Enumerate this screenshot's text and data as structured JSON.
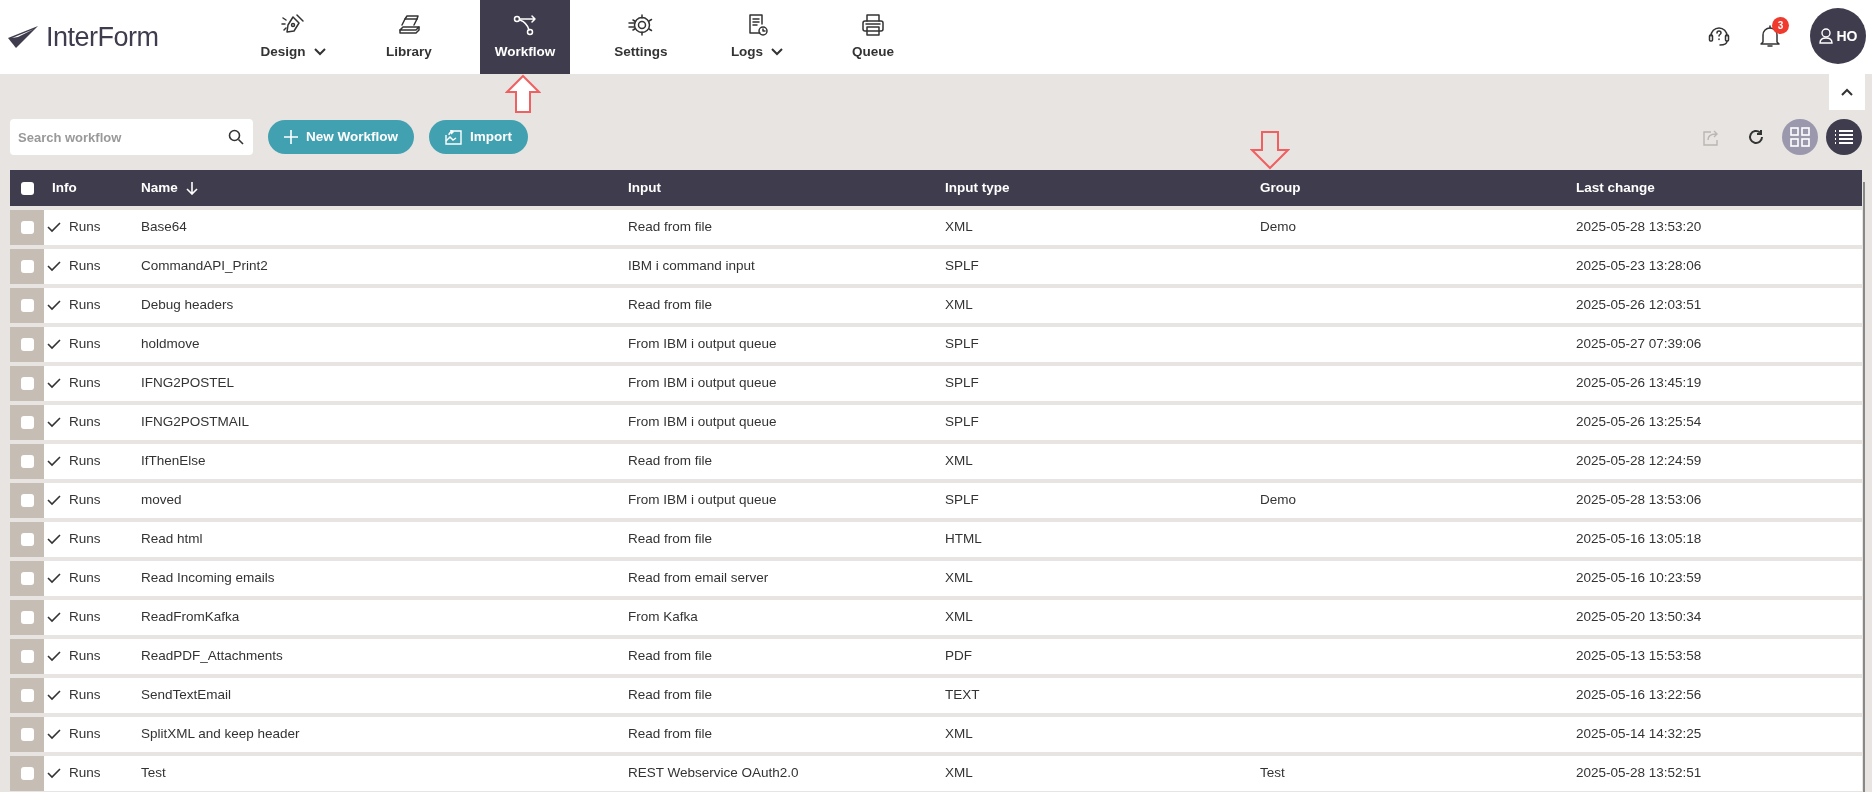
{
  "app": {
    "logo": "InterForm"
  },
  "nav": [
    {
      "label": "Design",
      "dropdown": true,
      "selected": false
    },
    {
      "label": "Library",
      "dropdown": false,
      "selected": false
    },
    {
      "label": "Workflow",
      "dropdown": false,
      "selected": true
    },
    {
      "label": "Settings",
      "dropdown": false,
      "selected": false
    },
    {
      "label": "Logs",
      "dropdown": true,
      "selected": false
    },
    {
      "label": "Queue",
      "dropdown": false,
      "selected": false
    }
  ],
  "header_actions": {
    "notification_count": "3",
    "user_initials": "HO"
  },
  "toolbar": {
    "search": {
      "placeholder": "Search workflow"
    },
    "buttons": [
      {
        "label": "New Workflow",
        "kind": "new"
      },
      {
        "label": "Import",
        "kind": "import"
      }
    ],
    "tools": [
      {
        "kind": "export",
        "disabled": true
      },
      {
        "kind": "refresh",
        "disabled": false
      }
    ],
    "views": [
      {
        "kind": "grid",
        "selected": false
      },
      {
        "kind": "list",
        "selected": true
      }
    ]
  },
  "table": {
    "all_checked": false,
    "columns": [
      {
        "label": "Info",
        "sorted": false
      },
      {
        "label": "Name",
        "sorted": true
      },
      {
        "label": "Input",
        "sorted": false
      },
      {
        "label": "Input type",
        "sorted": false
      },
      {
        "label": "Group",
        "sorted": false
      },
      {
        "label": "Last change",
        "sorted": false
      }
    ],
    "rows": [
      {
        "checked": false,
        "status": "Runs",
        "name": "Base64",
        "input": "Read from file",
        "input_type": "XML",
        "group": "Demo",
        "last_change": "2025-05-28 13:53:20"
      },
      {
        "checked": false,
        "status": "Runs",
        "name": "CommandAPI_Print2",
        "input": "IBM i command input",
        "input_type": "SPLF",
        "group": "",
        "last_change": "2025-05-23 13:28:06"
      },
      {
        "checked": false,
        "status": "Runs",
        "name": "Debug headers",
        "input": "Read from file",
        "input_type": "XML",
        "group": "",
        "last_change": "2025-05-26 12:03:51"
      },
      {
        "checked": false,
        "status": "Runs",
        "name": "holdmove",
        "input": "From IBM i output queue",
        "input_type": "SPLF",
        "group": "",
        "last_change": "2025-05-27 07:39:06"
      },
      {
        "checked": false,
        "status": "Runs",
        "name": "IFNG2POSTEL",
        "input": "From IBM i output queue",
        "input_type": "SPLF",
        "group": "",
        "last_change": "2025-05-26 13:45:19"
      },
      {
        "checked": false,
        "status": "Runs",
        "name": "IFNG2POSTMAIL",
        "input": "From IBM i output queue",
        "input_type": "SPLF",
        "group": "",
        "last_change": "2025-05-26 13:25:54"
      },
      {
        "checked": false,
        "status": "Runs",
        "name": "IfThenElse",
        "input": "Read from file",
        "input_type": "XML",
        "group": "",
        "last_change": "2025-05-28 12:24:59"
      },
      {
        "checked": false,
        "status": "Runs",
        "name": "moved",
        "input": "From IBM i output queue",
        "input_type": "SPLF",
        "group": "Demo",
        "last_change": "2025-05-28 13:53:06"
      },
      {
        "checked": false,
        "status": "Runs",
        "name": "Read html",
        "input": "Read from file",
        "input_type": "HTML",
        "group": "",
        "last_change": "2025-05-16 13:05:18"
      },
      {
        "checked": false,
        "status": "Runs",
        "name": "Read Incoming emails",
        "input": "Read from email server",
        "input_type": "XML",
        "group": "",
        "last_change": "2025-05-16 10:23:59"
      },
      {
        "checked": false,
        "status": "Runs",
        "name": "ReadFromKafka",
        "input": "From Kafka",
        "input_type": "XML",
        "group": "",
        "last_change": "2025-05-20 13:50:34"
      },
      {
        "checked": false,
        "status": "Runs",
        "name": "ReadPDF_Attachments",
        "input": "Read from file",
        "input_type": "PDF",
        "group": "",
        "last_change": "2025-05-13 15:53:58"
      },
      {
        "checked": false,
        "status": "Runs",
        "name": "SendTextEmail",
        "input": "Read from file",
        "input_type": "TEXT",
        "group": "",
        "last_change": "2025-05-16 13:22:56"
      },
      {
        "checked": false,
        "status": "Runs",
        "name": "SplitXML and keep header",
        "input": "Read from file",
        "input_type": "XML",
        "group": "",
        "last_change": "2025-05-14 14:32:25"
      },
      {
        "checked": false,
        "status": "Runs",
        "name": "Test",
        "input": "REST Webservice OAuth2.0",
        "input_type": "XML",
        "group": "Test",
        "last_change": "2025-05-28 13:52:51"
      }
    ]
  }
}
